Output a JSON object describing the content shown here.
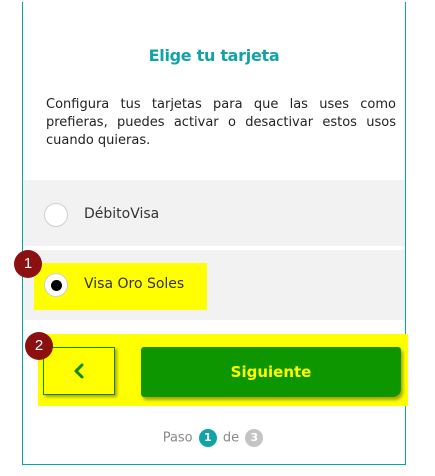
{
  "card": {
    "title": "Elige tu tarjeta",
    "description": "Configura tus tarjetas para que las uses como prefieras, puedes activar o desactivar estos usos cuando quieras."
  },
  "options": [
    {
      "label": "DébitoVisa",
      "selected": false
    },
    {
      "label": "Visa Oro Soles",
      "selected": true
    }
  ],
  "buttons": {
    "back_icon": "chevron-left-icon",
    "next_label": "Siguiente"
  },
  "steps": {
    "prefix": "Paso",
    "current": "1",
    "connector": "de",
    "total": "3"
  },
  "annotations": {
    "badge_1": "1",
    "badge_2": "2"
  },
  "colors": {
    "accent": "#12a3a8",
    "primary_button": "#0d9600",
    "highlight": "#ffff00",
    "badge": "#8c1010"
  }
}
